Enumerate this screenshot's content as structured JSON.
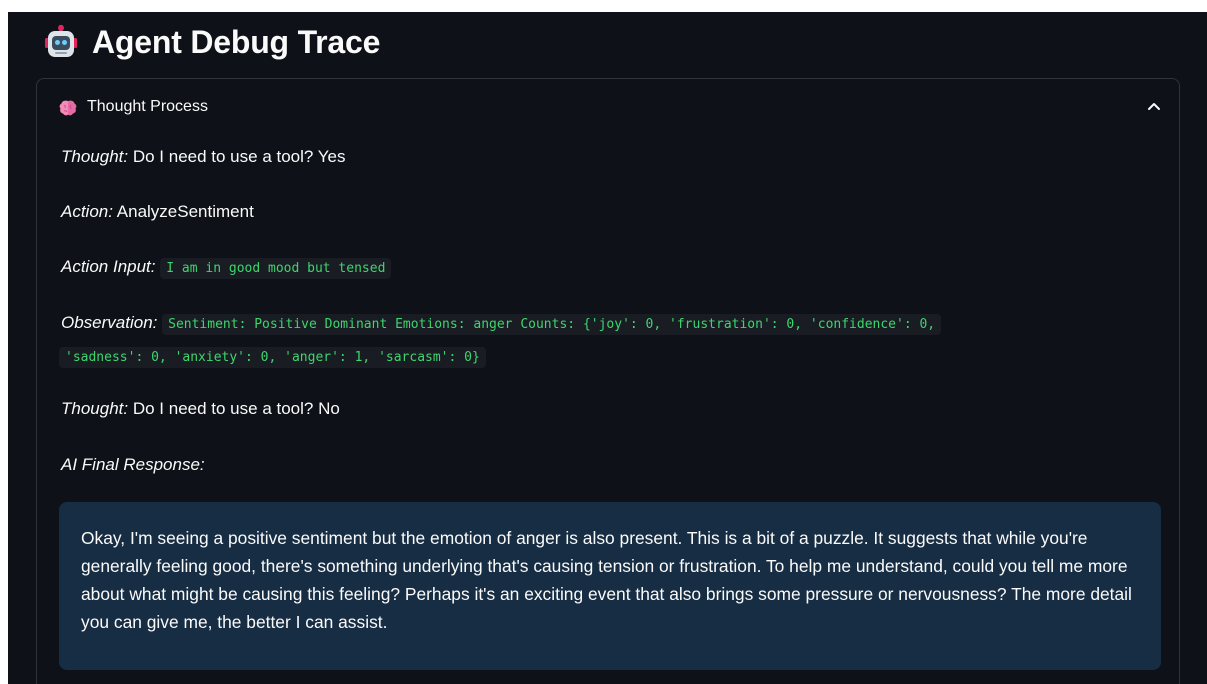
{
  "page": {
    "title": "Agent Debug Trace",
    "icon": "robot-icon"
  },
  "expander": {
    "label": "Thought Process",
    "icon": "brain-icon",
    "toggle_icon": "chevron-up-icon",
    "expanded": true
  },
  "trace": {
    "thought1_label": "Thought:",
    "thought1_text": "Do I need to use a tool? Yes",
    "action_label": "Action:",
    "action_text": "AnalyzeSentiment",
    "action_input_label": "Action Input:",
    "action_input_code": "I am in good mood but tensed",
    "observation_label": "Observation:",
    "observation_code_line1": "Sentiment: Positive Dominant Emotions: anger Counts: {'joy': 0, 'frustration': 0, 'confidence': 0,",
    "observation_code_line2": "'sadness': 0, 'anxiety': 0, 'anger': 1, 'sarcasm': 0}",
    "thought2_label": "Thought:",
    "thought2_text": "Do I need to use a tool? No",
    "final_response_label": "AI Final Response:"
  },
  "response": {
    "text": "Okay, I'm seeing a positive sentiment but the emotion of anger is also present. This is a bit of a puzzle. It suggests that while you're generally feeling good, there's something underlying that's causing tension or frustration. To help me understand, could you tell me more about what might be causing this feeling? Perhaps it's an exciting event that also brings some pressure or nervousness? The more detail you can give me, the better I can assist."
  },
  "colors": {
    "background": "#0e1117",
    "code_text": "#3dd56d",
    "code_background": "#1a1c24",
    "response_background": "#172d43",
    "expander_border": "#2f333d"
  }
}
